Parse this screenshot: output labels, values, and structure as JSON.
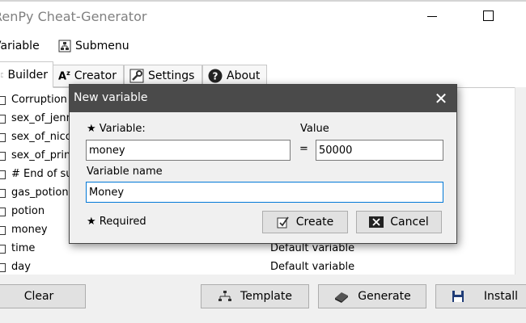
{
  "window": {
    "title": "RenPy Cheat-Generator"
  },
  "menu": {
    "items": [
      {
        "label": "Variable"
      },
      {
        "label": "Submenu"
      }
    ]
  },
  "tabs": [
    {
      "label": "Builder"
    },
    {
      "label": "Creator"
    },
    {
      "label": "Settings"
    },
    {
      "label": "About"
    }
  ],
  "list": {
    "rows": [
      {
        "name": "Corruption",
        "desc": ""
      },
      {
        "name": "sex_of_jenn",
        "desc": ""
      },
      {
        "name": "sex_of_nico",
        "desc": ""
      },
      {
        "name": "sex_of_prin",
        "desc": ""
      },
      {
        "name": "# End of su",
        "desc": ""
      },
      {
        "name": "gas_potion",
        "desc": ""
      },
      {
        "name": "potion",
        "desc": ""
      },
      {
        "name": "money",
        "desc": ""
      },
      {
        "name": "time",
        "desc": "Default variable"
      },
      {
        "name": "day",
        "desc": "Default variable"
      }
    ]
  },
  "buttons": {
    "clear": "Clear",
    "template": "Template",
    "generate": "Generate",
    "install": "Install"
  },
  "dialog": {
    "title": "New variable",
    "variable_label": "★ Variable:",
    "variable_value": "money",
    "equals": "=",
    "value_label": "Value",
    "value_value": "50000",
    "name_label": "Variable name",
    "name_value": "Money",
    "required_note": "★ Required",
    "create_label": "Create",
    "cancel_label": "Cancel"
  }
}
